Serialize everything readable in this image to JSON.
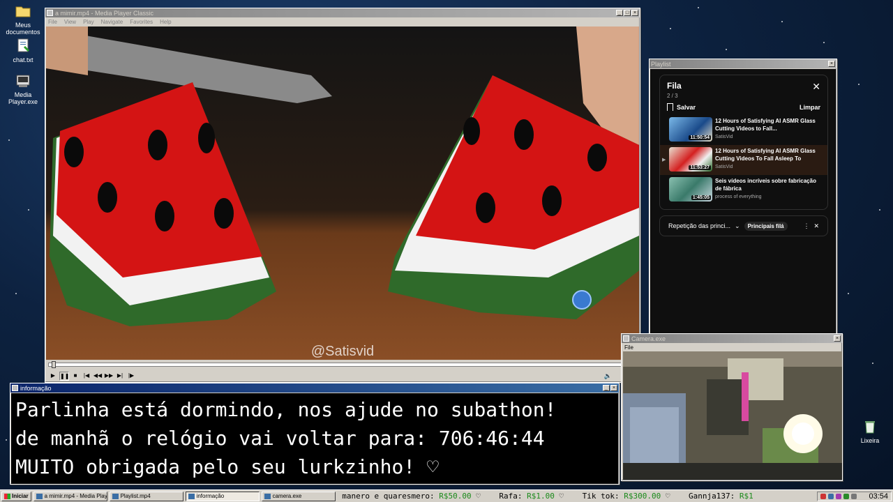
{
  "desktop": {
    "icons": [
      {
        "label": "Meus documentos",
        "icon": "folder-icon"
      },
      {
        "label": "chat.txt",
        "icon": "text-file-icon"
      },
      {
        "label": "Media Player.exe",
        "icon": "media-player-icon"
      },
      {
        "label": "Lixeira",
        "icon": "recycle-bin-icon"
      }
    ]
  },
  "player": {
    "title": "a mimir.mp4 - Media Player Classic",
    "menu": [
      "File",
      "View",
      "Play",
      "Navigate",
      "Favorites",
      "Help"
    ],
    "watermark": "@Satisvid",
    "progress": 0.005
  },
  "playlist_window": {
    "title": "Playlist",
    "panel": {
      "title": "Fila",
      "count": "2 / 3",
      "save_label": "Salvar",
      "clear_label": "Limpar",
      "items": [
        {
          "title": "12 Hours of Satisfying AI ASMR Glass Cutting Videos to Fall...",
          "channel": "SatisVid",
          "duration": "11:50:54",
          "current": false
        },
        {
          "title": "12 Hours of Satisfying AI ASMR Glass Cutting Videos To Fall Asleep To",
          "channel": "SatisVid",
          "duration": "11:53:27",
          "current": true
        },
        {
          "title": "Seis vídeos incríveis sobre fabricação de fábrica",
          "channel": "process of everything",
          "duration": "1:45:05",
          "current": false
        }
      ]
    },
    "loop_bar": {
      "label": "Repetição das princi...",
      "chip": "Principais filá"
    }
  },
  "info_window": {
    "title": "informação",
    "lines": [
      "Parlinha está dormindo, nos ajude no subathon!",
      "de manhã o relógio vai voltar para:  706:46:44",
      "MUITO obrigada pelo seu lurkzinho! ♡"
    ]
  },
  "camera_window": {
    "title": "Camera.exe",
    "menu": [
      "File"
    ]
  },
  "taskbar": {
    "start_label": "Iniciar",
    "items": [
      {
        "label": "a mimir.mp4 - Media Playe...",
        "active": false
      },
      {
        "label": "Playlist.mp4",
        "active": false
      },
      {
        "label": "informação",
        "active": true
      },
      {
        "label": "camera.exe",
        "active": false
      }
    ],
    "ticker": [
      {
        "name": "manero e quaresmero:",
        "amount": "R$50.00"
      },
      {
        "name": "Rafa:",
        "amount": "R$1.00"
      },
      {
        "name": "Tik tok:",
        "amount": "R$300.00"
      },
      {
        "name": "Gannja137:",
        "amount": "R$1"
      }
    ],
    "clock": "03:54"
  }
}
